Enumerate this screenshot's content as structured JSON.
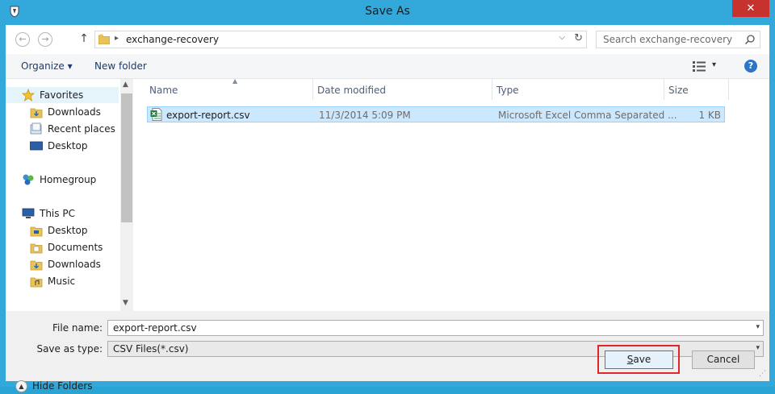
{
  "window": {
    "title": "Save As",
    "close_glyph": "✕",
    "app_icon": "shield-app-icon"
  },
  "navigation": {
    "back_glyph": "←",
    "forward_glyph": "→",
    "up_glyph": "↑"
  },
  "address": {
    "separator": "▸",
    "path": "exchange-recovery",
    "dropdown_glyph": "⌵",
    "refresh_glyph": "↻"
  },
  "search": {
    "placeholder": "Search exchange-recovery"
  },
  "toolbar": {
    "organize_label": "Organize ▾",
    "new_folder_label": "New folder",
    "view_arrow": "▾",
    "help_glyph": "?"
  },
  "sidebar": {
    "items": [
      {
        "label": "Favorites",
        "icon": "star-icon"
      },
      {
        "label": "Downloads",
        "icon": "downloads-folder-icon"
      },
      {
        "label": "Recent places",
        "icon": "recent-places-icon"
      },
      {
        "label": "Desktop",
        "icon": "desktop-icon"
      },
      {
        "label": "Homegroup",
        "icon": "homegroup-icon"
      },
      {
        "label": "This PC",
        "icon": "computer-icon"
      },
      {
        "label": "Desktop",
        "icon": "desktop-folder-icon"
      },
      {
        "label": "Documents",
        "icon": "documents-folder-icon"
      },
      {
        "label": "Downloads",
        "icon": "downloads-folder-icon"
      },
      {
        "label": "Music",
        "icon": "music-folder-icon"
      }
    ],
    "scroll_up": "▲",
    "scroll_down": "▼"
  },
  "file_list": {
    "columns": [
      "Name",
      "Date modified",
      "Type",
      "Size"
    ],
    "sort_indicator": "▲",
    "rows": [
      {
        "name": "export-report.csv",
        "date_modified": "11/3/2014 5:09 PM",
        "type": "Microsoft Excel Comma Separated ...",
        "size": "1 KB",
        "icon": "excel-csv-icon"
      }
    ]
  },
  "form": {
    "file_name_label": "File name:",
    "file_name_value": "export-report.csv",
    "save_type_label": "Save as type:",
    "save_type_value": "CSV Files(*.csv)",
    "dropdown_glyph": "▾"
  },
  "footer": {
    "hide_folders_label": "Hide Folders",
    "hide_folders_glyph": "▲",
    "save_label_underlined": "S",
    "save_label_rest": "ave",
    "cancel_label": "Cancel",
    "grip_glyph": "⋰"
  },
  "colors": {
    "accent": "#32a9da",
    "close": "#c7322f",
    "selection": "#cce8ff",
    "highlight_box": "#e0262b"
  }
}
